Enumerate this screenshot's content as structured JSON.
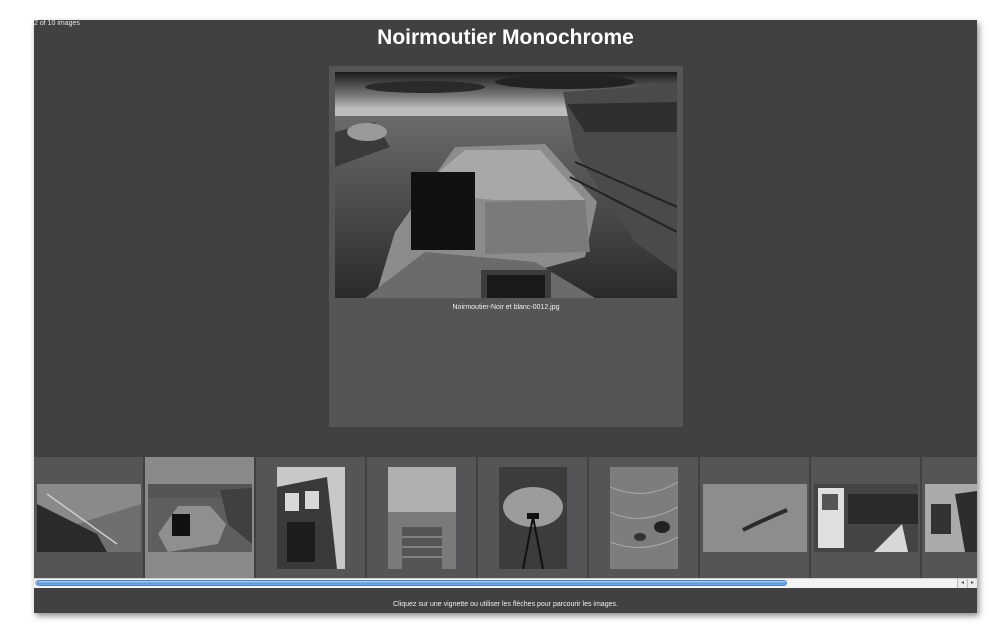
{
  "gallery": {
    "counter": "2 of 10 images",
    "title": "Noirmoutier Monochrome",
    "current_file": "Noirmoutier-Noir et blanc-0012.jpg",
    "hint": "Cliquez sur une vignette ou utiliser les flèches pour parcourir les images."
  },
  "colors": {
    "window_bg": "#414042",
    "panel_bg": "#555457",
    "selected_thumb_bg": "#8a8a8c",
    "scroll_accent": "#5d96d8"
  },
  "thumbnails": {
    "selected_index": 1,
    "count_visible": 9
  },
  "scrollbar": {
    "left_arrow": "◂",
    "right_arrow": "▸"
  }
}
